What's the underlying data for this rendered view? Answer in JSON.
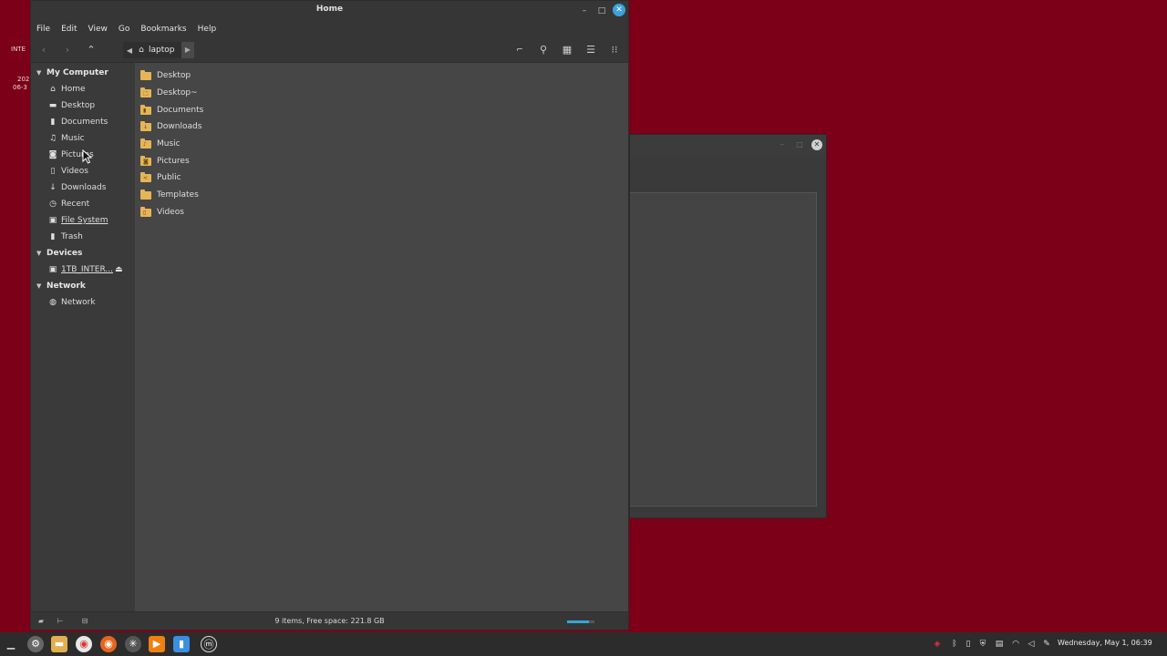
{
  "desktop": {
    "fragment1": "INTE",
    "fragment2": "202",
    "fragment3": "06-3"
  },
  "window": {
    "title": "Home",
    "minimize_icon": "minimize-icon",
    "maximize_icon": "maximize-icon",
    "close_icon": "close-icon"
  },
  "menubar": [
    "File",
    "Edit",
    "View",
    "Go",
    "Bookmarks",
    "Help"
  ],
  "toolbar": {
    "location": "laptop"
  },
  "sidebar": {
    "sections": [
      {
        "title": "My Computer",
        "items": [
          {
            "label": "Home",
            "icon": "home-icon"
          },
          {
            "label": "Desktop",
            "icon": "desktop-icon"
          },
          {
            "label": "Documents",
            "icon": "documents-icon"
          },
          {
            "label": "Music",
            "icon": "music-icon"
          },
          {
            "label": "Pictures",
            "icon": "camera-icon"
          },
          {
            "label": "Videos",
            "icon": "film-icon"
          },
          {
            "label": "Downloads",
            "icon": "download-icon"
          },
          {
            "label": "Recent",
            "icon": "clock-icon"
          },
          {
            "label": "File System",
            "icon": "drive-icon"
          },
          {
            "label": "Trash",
            "icon": "trash-icon"
          }
        ]
      },
      {
        "title": "Devices",
        "items": [
          {
            "label": "1TB_INTER...",
            "icon": "drive-icon"
          }
        ]
      },
      {
        "title": "Network",
        "items": [
          {
            "label": "Network",
            "icon": "network-icon"
          }
        ]
      }
    ]
  },
  "files": [
    {
      "name": "Desktop",
      "icon": "folder-icon"
    },
    {
      "name": "Desktop~",
      "icon": "folder-icon"
    },
    {
      "name": "Documents",
      "icon": "folder-icon"
    },
    {
      "name": "Downloads",
      "icon": "folder-icon"
    },
    {
      "name": "Music",
      "icon": "folder-icon"
    },
    {
      "name": "Pictures",
      "icon": "folder-icon"
    },
    {
      "name": "Public",
      "icon": "folder-icon"
    },
    {
      "name": "Templates",
      "icon": "folder-icon"
    },
    {
      "name": "Videos",
      "icon": "folder-icon"
    }
  ],
  "statusbar": {
    "text": "9 items, Free space: 221.8 GB",
    "zoom_level": 0.8
  },
  "taskbar": {
    "clock": "Wednesday, May 1, 06:39"
  },
  "colors": {
    "desktop": "#7c0017",
    "accent": "#3aa3d9",
    "folder": "#e6b556"
  }
}
